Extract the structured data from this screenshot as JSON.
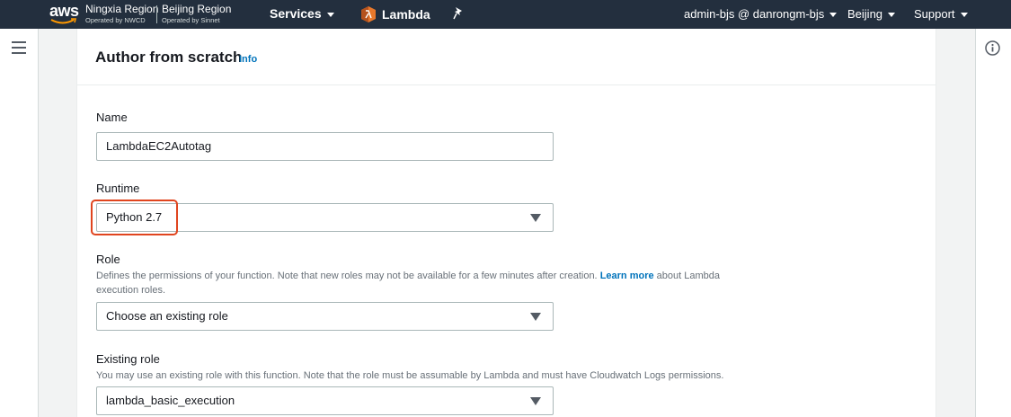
{
  "topnav": {
    "logo_text": "aws",
    "regions": [
      {
        "name": "Ningxia Region",
        "operator": "Operated by NWCD"
      },
      {
        "name": "Beijing Region",
        "operator": "Operated by Sinnet"
      }
    ],
    "services_label": "Services",
    "service_name": "Lambda",
    "account_label": "admin-bjs @ danrongm-bjs",
    "region_label": "Beijing",
    "support_label": "Support",
    "colors": {
      "bar": "#232f3e",
      "accent": "#ff9900",
      "lambda_icon": "#e7782b"
    }
  },
  "panel": {
    "title": "Author from scratch",
    "info_link": "Info"
  },
  "form": {
    "name": {
      "label": "Name",
      "value": "LambdaEC2Autotag"
    },
    "runtime": {
      "label": "Runtime",
      "value": "Python 2.7"
    },
    "role": {
      "label": "Role",
      "desc_before": "Defines the permissions of your function. Note that new roles may not be available for a few minutes after creation.",
      "desc_link": "Learn more",
      "desc_after": "about Lambda execution roles.",
      "value": "Choose an existing role"
    },
    "existing_role": {
      "label": "Existing role",
      "desc": "You may use an existing role with this function. Note that the role must be assumable by Lambda and must have Cloudwatch Logs permissions.",
      "value": "lambda_basic_execution"
    }
  },
  "highlight_color": "#e0451f",
  "link_color": "#0073bb"
}
